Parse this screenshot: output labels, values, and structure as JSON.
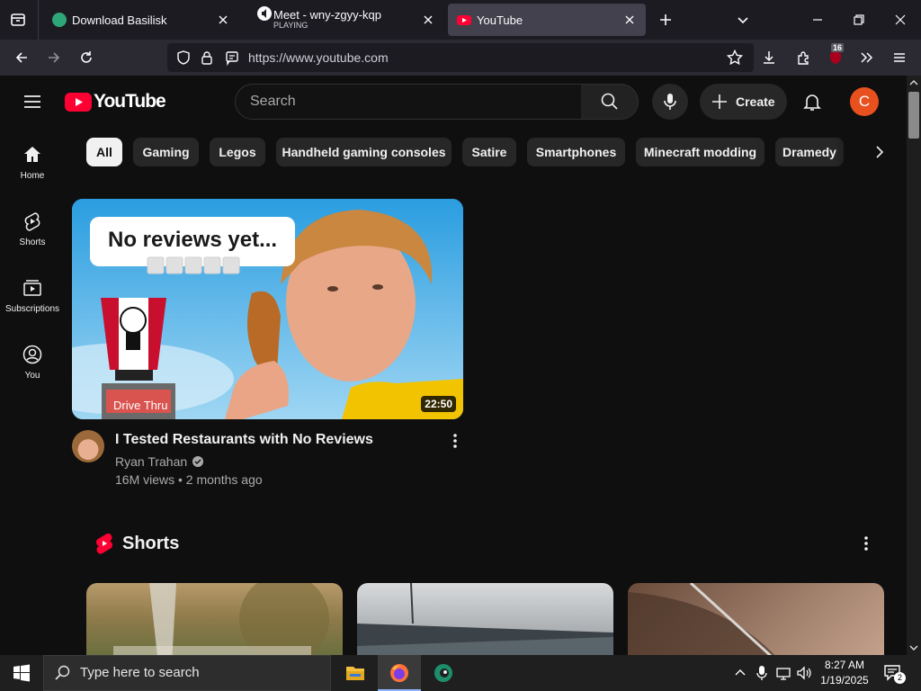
{
  "browser": {
    "tabs": [
      {
        "title": "Download Basilisk",
        "active": false
      },
      {
        "title": "Meet - wny-zgyy-kqp",
        "subtitle": "PLAYING",
        "active": false
      },
      {
        "title": "YouTube",
        "active": true
      }
    ],
    "url": "https://www.youtube.com",
    "extension_badge": "16"
  },
  "youtube": {
    "logo_text": "YouTube",
    "search_placeholder": "Search",
    "create_label": "Create",
    "avatar_letter": "C",
    "chips": [
      "All",
      "Gaming",
      "Legos",
      "Handheld gaming consoles",
      "Satire",
      "Smartphones",
      "Minecraft modding",
      "Dramedy"
    ],
    "sidebar": [
      {
        "label": "Home",
        "icon": "home-icon"
      },
      {
        "label": "Shorts",
        "icon": "shorts-icon"
      },
      {
        "label": "Subscriptions",
        "icon": "subscriptions-icon"
      },
      {
        "label": "You",
        "icon": "you-icon"
      }
    ],
    "video": {
      "title": "I Tested Restaurants with No Reviews",
      "channel": "Ryan Trahan",
      "meta": "16M views • 2 months ago",
      "duration": "22:50",
      "thumb_text": "No reviews yet...",
      "thumb_sign": "Drive Thru"
    },
    "shorts_heading": "Shorts"
  },
  "taskbar": {
    "search_placeholder": "Type here to search",
    "time": "8:27 AM",
    "date": "1/19/2025",
    "notification_count": "2"
  },
  "colors": {
    "youtube_red": "#ff0033",
    "background": "#0f0f0f",
    "chip": "#272727",
    "avatar": "#e8501e"
  }
}
